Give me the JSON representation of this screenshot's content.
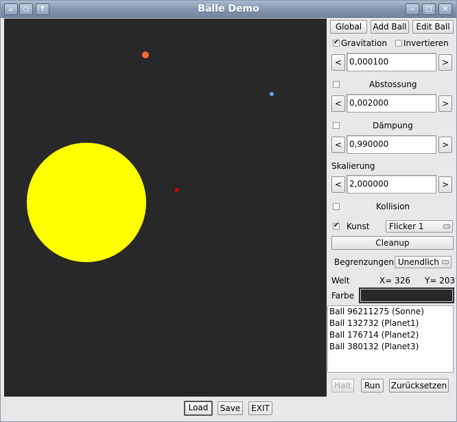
{
  "window": {
    "title": "Bälle Demo",
    "icons": [
      "app-icon",
      "window-menu-icon",
      "pin-icon",
      "minimize-icon",
      "maximize-icon",
      "close-icon"
    ]
  },
  "canvas": {
    "background": "#282828",
    "balls": [
      {
        "name": "Sonne",
        "color": "#ffff00"
      },
      {
        "name": "Planet1",
        "color": "#ff6633"
      },
      {
        "name": "Planet2",
        "color": "#6699ff"
      },
      {
        "name": "Planet3",
        "color": "#dd0000"
      }
    ]
  },
  "sidebar": {
    "global_button": "Global",
    "add_ball_button": "Add Ball",
    "edit_ball_button": "Edit Ball",
    "gravitation": {
      "label": "Gravitation",
      "checked": true,
      "value": "0,000100"
    },
    "invertieren": {
      "label": "Invertieren",
      "checked": false
    },
    "abstossung": {
      "label": "Abstossung",
      "checked": false,
      "value": "0,002000"
    },
    "daempfung": {
      "label": "Dämpung",
      "checked": false,
      "value": "0,990000"
    },
    "skalierung": {
      "label": "Skalierung",
      "value": "2,000000"
    },
    "kollision": {
      "label": "Kollision",
      "checked": false
    },
    "kunst": {
      "label": "Kunst",
      "checked": true,
      "selected": "Flicker 1"
    },
    "cleanup_button": "Cleanup",
    "begrenzungen": {
      "label": "Begrenzungen",
      "selected": "Unendlich"
    },
    "welt": {
      "label": "Welt",
      "x": "X= 326",
      "y": "Y= 203"
    },
    "farbe": {
      "label": "Farbe",
      "color": "#282828"
    },
    "decrement": "<",
    "increment": ">",
    "ball_list": [
      "Ball 96211275 (Sonne)",
      "Ball 132732 (Planet1)",
      "Ball 176714 (Planet2)",
      "Ball 380132 (Planet3)"
    ],
    "halt_button": "Halt",
    "run_button": "Run",
    "reset_button": "Zurücksetzen"
  },
  "footer": {
    "load_button": "Load",
    "save_button": "Save",
    "exit_button": "EXIT"
  }
}
